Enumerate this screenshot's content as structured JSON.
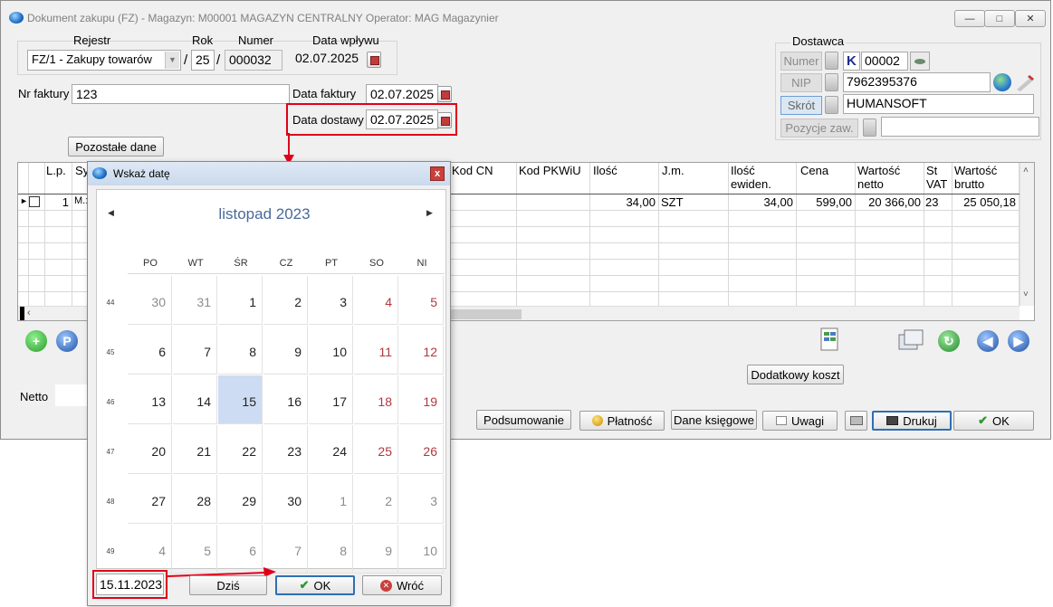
{
  "window": {
    "title": "Dokument zakupu (FZ) - Magazyn: M00001 MAGAZYN CENTRALNY  Operator: MAG Magazynier",
    "minimize_icon": "minimize-icon",
    "maximize_icon": "maximize-icon",
    "close_icon": "close-icon"
  },
  "header": {
    "rejestr_label": "Rejestr",
    "rok_label": "Rok",
    "numer_label": "Numer",
    "data_wplywu_label": "Data wpływu",
    "rejestr_value": "FZ/1   - Zakupy towarów",
    "slash": "/",
    "rok_value": "25",
    "numer_value": "000032",
    "data_wplywu_value": "02.07.2025",
    "nr_faktury_label": "Nr faktury",
    "nr_faktury_value": "123",
    "data_faktury_label": "Data faktury",
    "data_faktury_value": "02.07.2025",
    "data_dostawy_label": "Data dostawy",
    "data_dostawy_value": "02.07.2025",
    "pozostale_dane_label": "Pozostałe dane"
  },
  "dostawca": {
    "title": "Dostawca",
    "numer_label": "Numer",
    "k_label": "K",
    "numer_value": "00002",
    "nip_label": "NIP",
    "nip_value": "7962395376",
    "skrot_label": "Skrót",
    "skrot_value": "HUMANSOFT",
    "pozycje_label": "Pozycje zaw.",
    "pozycje_value": ""
  },
  "grid": {
    "columns": [
      "L.p.",
      "Sy",
      "Kod CN",
      "Kod PKWiU",
      "Ilość",
      "J.m.",
      "Ilość ewiden.",
      "Cena",
      "Wartość netto",
      "St VAT",
      "Wartość brutto"
    ],
    "rows": [
      {
        "lp": "1",
        "sy": "M.:",
        "ilosc": "34,00",
        "jm": "SZT",
        "ilosc_ewiden": "34,00",
        "cena": "599,00",
        "netto": "20 366,00",
        "vat": "23",
        "brutto": "25 050,18"
      }
    ]
  },
  "buttons": {
    "dodatkowy_koszt": "Dodatkowy koszt",
    "podsumowanie": "Podsumowanie",
    "platnosc": "Płatność",
    "dane_ksiegowe": "Dane księgowe",
    "uwagi": "Uwagi",
    "drukuj": "Drukuj",
    "ok": "OK"
  },
  "netto_label": "Netto",
  "date_dialog": {
    "title": "Wskaż datę",
    "month_label": "listopad 2023",
    "weekdays": [
      "PO",
      "WT",
      "ŚR",
      "CZ",
      "PT",
      "SO",
      "NI"
    ],
    "weeks": [
      {
        "week": "44",
        "days": [
          "30",
          "31",
          "1",
          "2",
          "3",
          "4",
          "5"
        ]
      },
      {
        "week": "45",
        "days": [
          "6",
          "7",
          "8",
          "9",
          "10",
          "11",
          "12"
        ]
      },
      {
        "week": "46",
        "days": [
          "13",
          "14",
          "15",
          "16",
          "17",
          "18",
          "19"
        ]
      },
      {
        "week": "47",
        "days": [
          "20",
          "21",
          "22",
          "23",
          "24",
          "25",
          "26"
        ]
      },
      {
        "week": "48",
        "days": [
          "27",
          "28",
          "29",
          "30",
          "1",
          "2",
          "3"
        ]
      },
      {
        "week": "49",
        "days": [
          "4",
          "5",
          "6",
          "7",
          "8",
          "9",
          "10"
        ]
      }
    ],
    "selected_value": "15.11.2023",
    "dzis_label": "Dziś",
    "ok_label": "OK",
    "wroc_label": "Wróć"
  },
  "colors": {
    "highlight_red": "#e0001a",
    "selected_day": "#cddcf3",
    "weekend_text": "#b3373e",
    "month_title": "#4a6a9a"
  }
}
